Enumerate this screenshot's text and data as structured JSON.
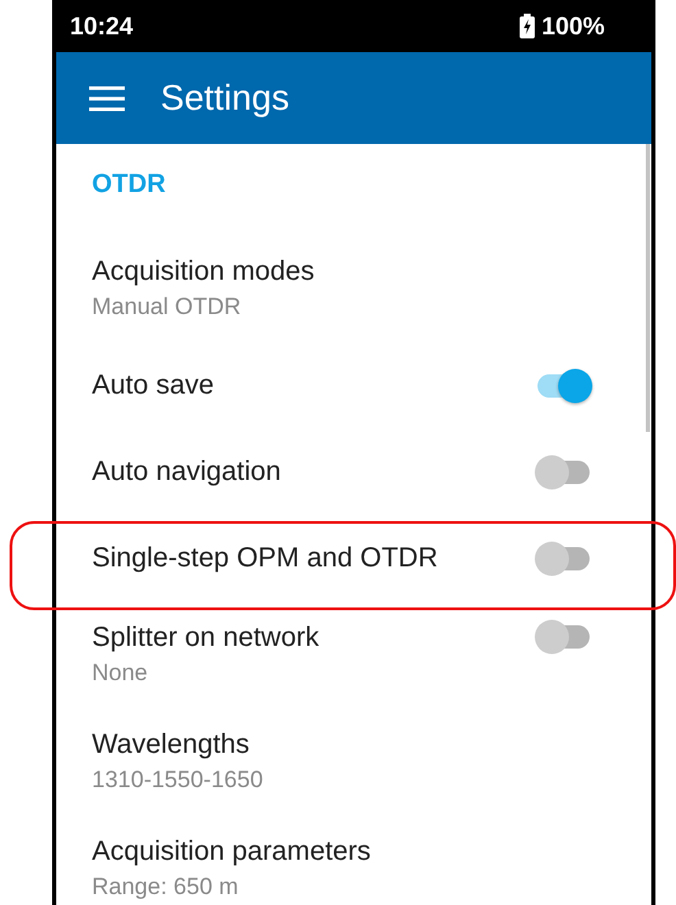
{
  "status_bar": {
    "time": "10:24",
    "battery": "100%"
  },
  "app_bar": {
    "title": "Settings"
  },
  "section": {
    "title": "OTDR"
  },
  "items": [
    {
      "kind": "link",
      "title": "Acquisition modes",
      "subtitle": "Manual OTDR",
      "highlighted": false
    },
    {
      "kind": "switch",
      "title": "Auto save",
      "on": true,
      "highlighted": false
    },
    {
      "kind": "switch",
      "title": "Auto navigation",
      "on": false,
      "highlighted": false
    },
    {
      "kind": "switch",
      "title": "Single-step OPM and OTDR",
      "on": false,
      "highlighted": true
    },
    {
      "kind": "switch",
      "title": "Splitter on network",
      "subtitle": "None",
      "on": false,
      "highlighted": false
    },
    {
      "kind": "link",
      "title": "Wavelengths",
      "subtitle": "1310-1550-1650",
      "highlighted": false
    },
    {
      "kind": "link",
      "title": "Acquisition parameters",
      "subtitle": "Range: 650 m",
      "highlighted": false
    }
  ]
}
